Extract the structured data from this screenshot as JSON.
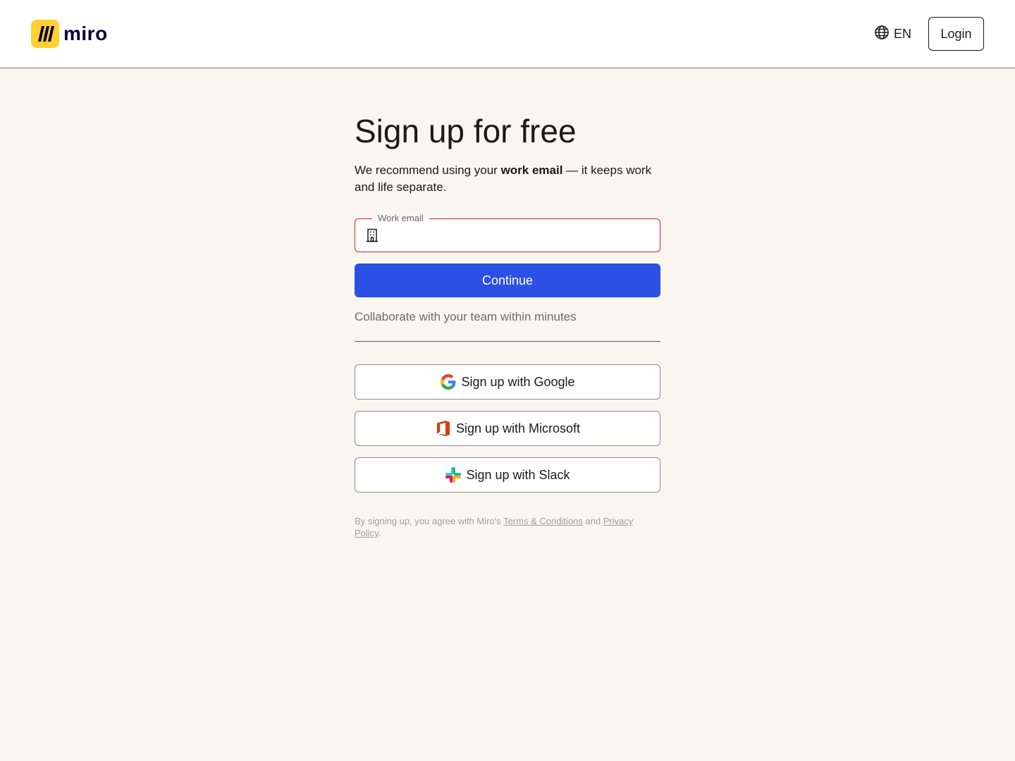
{
  "header": {
    "logo_text": "miro",
    "lang_label": "EN",
    "login_label": "Login"
  },
  "signup": {
    "title": "Sign up for free",
    "subtitle_pre": "We recommend using your ",
    "subtitle_bold": "work email",
    "subtitle_post": " — it keeps work and life separate.",
    "email_label": "Work email",
    "email_value": "",
    "continue_label": "Continue",
    "collab_text": "Collaborate with your team within minutes",
    "google_label": "Sign up with Google",
    "microsoft_label": "Sign up with Microsoft",
    "slack_label": "Sign up with Slack"
  },
  "legal": {
    "pre": "By signing up, you agree with Miro's ",
    "terms_label": "Terms & Conditions",
    "mid": " and ",
    "privacy_label": "Privacy Policy",
    "post": "."
  },
  "colors": {
    "page_bg": "#f9f5ef",
    "primary": "#2c4fe6",
    "error_border": "#d0232f",
    "brand_yellow": "#ffd02f"
  }
}
